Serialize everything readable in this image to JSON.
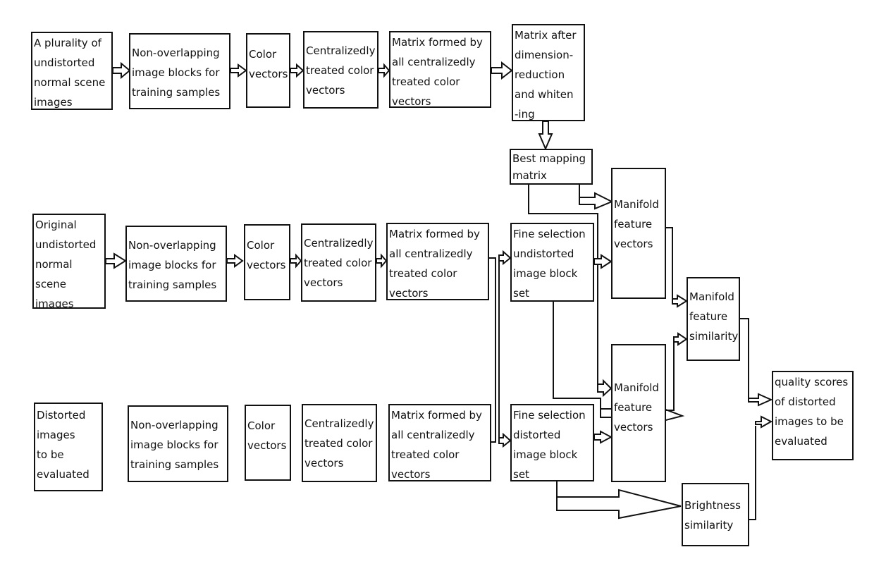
{
  "diagram": {
    "nodes": {
      "r1_input": "A plurality of\nundistorted\nnormal scene\nimages",
      "r1_blocks": "Non-overlapping\nimage blocks for\ntraining samples",
      "r1_color": "Color\nvectors",
      "r1_central": "Centralizedly\ntreated color\nvectors",
      "r1_matrix": "Matrix formed by\nall centralizedly\ntreated color\nvectors",
      "r1_whiten": "Matrix after\ndimension-\nreduction\nand whiten\n-ing",
      "best_mapping": "Best mapping\nmatrix",
      "r2_input": "Original\nundistorted\nnormal\nscene\nimages",
      "r2_blocks": "Non-overlapping\nimage blocks for\ntraining samples",
      "r2_color": "Color\nvectors",
      "r2_central": "Centralizedly\ntreated color\nvectors",
      "r2_matrix": "Matrix formed by\nall centralizedly\ntreated color\nvectors",
      "fine_undistorted": "Fine selection\nundistorted\nimage block\nset",
      "manifold_vec_1": "Manifold\nfeature\nvectors",
      "manifold_similarity": "Manifold\nfeature\nsimilarity",
      "r3_input": "Distorted\nimages\nto be\nevaluated",
      "r3_blocks": "Non-overlapping\nimage blocks for\ntraining samples",
      "r3_color": "Color\nvectors",
      "r3_central": "Centralizedly\ntreated color\nvectors",
      "r3_matrix": "Matrix formed by\nall centralizedly\ntreated color\nvectors",
      "fine_distorted": "Fine selection\ndistorted\nimage block\nset",
      "manifold_vec_2": "Manifold\nfeature\nvectors",
      "brightness_similarity": "Brightness\nsimilarity",
      "quality_scores": "quality scores\nof distorted\nimages to be\nevaluated"
    },
    "edges": [
      [
        "r1_input",
        "r1_blocks"
      ],
      [
        "r1_blocks",
        "r1_color"
      ],
      [
        "r1_color",
        "r1_central"
      ],
      [
        "r1_central",
        "r1_matrix"
      ],
      [
        "r1_matrix",
        "r1_whiten"
      ],
      [
        "r1_whiten",
        "best_mapping"
      ],
      [
        "best_mapping",
        "manifold_vec_1"
      ],
      [
        "best_mapping",
        "manifold_vec_2"
      ],
      [
        "r2_input",
        "r2_blocks"
      ],
      [
        "r2_blocks",
        "r2_color"
      ],
      [
        "r2_color",
        "r2_central"
      ],
      [
        "r2_central",
        "r2_matrix"
      ],
      [
        "r2_matrix",
        "fine_undistorted"
      ],
      [
        "r2_matrix",
        "fine_distorted"
      ],
      [
        "r3_input",
        "r3_blocks"
      ],
      [
        "r3_blocks",
        "r3_color"
      ],
      [
        "r3_color",
        "r3_central"
      ],
      [
        "r3_central",
        "r3_matrix"
      ],
      [
        "r3_matrix",
        "fine_undistorted"
      ],
      [
        "r3_matrix",
        "fine_distorted"
      ],
      [
        "fine_undistorted",
        "manifold_vec_1"
      ],
      [
        "fine_distorted",
        "manifold_vec_2"
      ],
      [
        "fine_undistorted",
        "brightness_similarity"
      ],
      [
        "fine_distorted",
        "brightness_similarity"
      ],
      [
        "manifold_vec_1",
        "manifold_similarity"
      ],
      [
        "manifold_vec_2",
        "manifold_similarity"
      ],
      [
        "manifold_similarity",
        "quality_scores"
      ],
      [
        "brightness_similarity",
        "quality_scores"
      ]
    ]
  }
}
